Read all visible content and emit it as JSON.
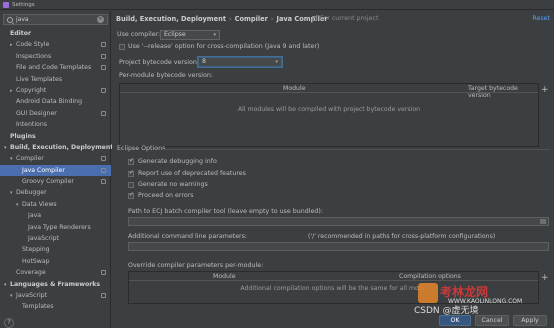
{
  "window": {
    "title": "Settings"
  },
  "sidebar": {
    "search_value": "java",
    "items": [
      {
        "label": "Editor",
        "type": "section"
      },
      {
        "label": "Code Style",
        "indent": 1,
        "arrow": "▸",
        "badge": true
      },
      {
        "label": "Inspections",
        "indent": 1,
        "badge": true
      },
      {
        "label": "File and Code Templates",
        "indent": 1,
        "badge": true
      },
      {
        "label": "Live Templates",
        "indent": 1
      },
      {
        "label": "Copyright",
        "indent": 1,
        "arrow": "▸",
        "badge": true
      },
      {
        "label": "Android Data Binding",
        "indent": 1
      },
      {
        "label": "GUI Designer",
        "indent": 1,
        "badge": true
      },
      {
        "label": "Intentions",
        "indent": 1
      },
      {
        "label": "Plugins",
        "type": "section"
      },
      {
        "label": "Build, Execution, Deployment",
        "type": "section",
        "arrow": "▾"
      },
      {
        "label": "Compiler",
        "indent": 1,
        "arrow": "▾",
        "badge": true
      },
      {
        "label": "Java Compiler",
        "indent": 2,
        "selected": true,
        "badge": true
      },
      {
        "label": "Groovy Compiler",
        "indent": 2,
        "badge": true
      },
      {
        "label": "Debugger",
        "indent": 1,
        "arrow": "▾"
      },
      {
        "label": "Data Views",
        "indent": 2,
        "arrow": "▾"
      },
      {
        "label": "Java",
        "indent": 3
      },
      {
        "label": "Java Type Renderers",
        "indent": 3
      },
      {
        "label": "JavaScript",
        "indent": 3
      },
      {
        "label": "Stepping",
        "indent": 2
      },
      {
        "label": "HotSwap",
        "indent": 2
      },
      {
        "label": "Coverage",
        "indent": 1,
        "badge": true
      },
      {
        "label": "Languages & Frameworks",
        "type": "section",
        "arrow": "▾"
      },
      {
        "label": "JavaScript",
        "indent": 1,
        "arrow": "▾",
        "badge": true
      },
      {
        "label": "Templates",
        "indent": 2
      }
    ],
    "help": "?"
  },
  "header": {
    "crumbs": [
      "Build, Execution, Deployment",
      "Compiler",
      "Java Compiler"
    ],
    "for_current_project": "For current project",
    "reset": "Reset"
  },
  "compiler": {
    "use_compiler_label": "Use compiler:",
    "use_compiler_value": "Eclipse",
    "release_option_label": "Use '--release' option for cross-compilation (Java 9 and later)",
    "bytecode_version_label": "Project bytecode version:",
    "bytecode_version_value": "8",
    "per_module_label": "Per-module bytecode version:",
    "module_table": {
      "col_module": "Module",
      "col_target": "Target bytecode version",
      "empty_text": "All modules will be compiled with project bytecode version"
    }
  },
  "eclipse": {
    "section_title": "Eclipse Options",
    "options": [
      {
        "label": "Generate debugging info",
        "checked": true
      },
      {
        "label": "Report use of deprecated features",
        "checked": true
      },
      {
        "label": "Generate no warnings",
        "checked": false
      },
      {
        "label": "Proceed on errors",
        "checked": true
      }
    ],
    "ecj_path_label": "Path to ECJ batch compiler tool (leave empty to use bundled):",
    "ecj_path_value": "",
    "additional_params_label": "Additional command line parameters:",
    "additional_params_hint": "('/' recommended in paths for cross-platform configurations)",
    "additional_params_value": "",
    "override_label": "Override compiler parameters per-module:",
    "override_table": {
      "col_module": "Module",
      "col_options": "Compilation options",
      "empty_text": "Additional compilation options will be the same for all modu"
    }
  },
  "footer": {
    "ok": "OK",
    "cancel": "Cancel",
    "apply": "Apply"
  },
  "watermark": {
    "brand": "考林龙网",
    "url": "WWW.KAOLINLONG.COM",
    "csdn": "CSDN @虚无境"
  },
  "colors": {
    "selection": "#4b6eaf",
    "link": "#589df6",
    "panel": "#3c3f41",
    "primary_button": "#365880"
  }
}
